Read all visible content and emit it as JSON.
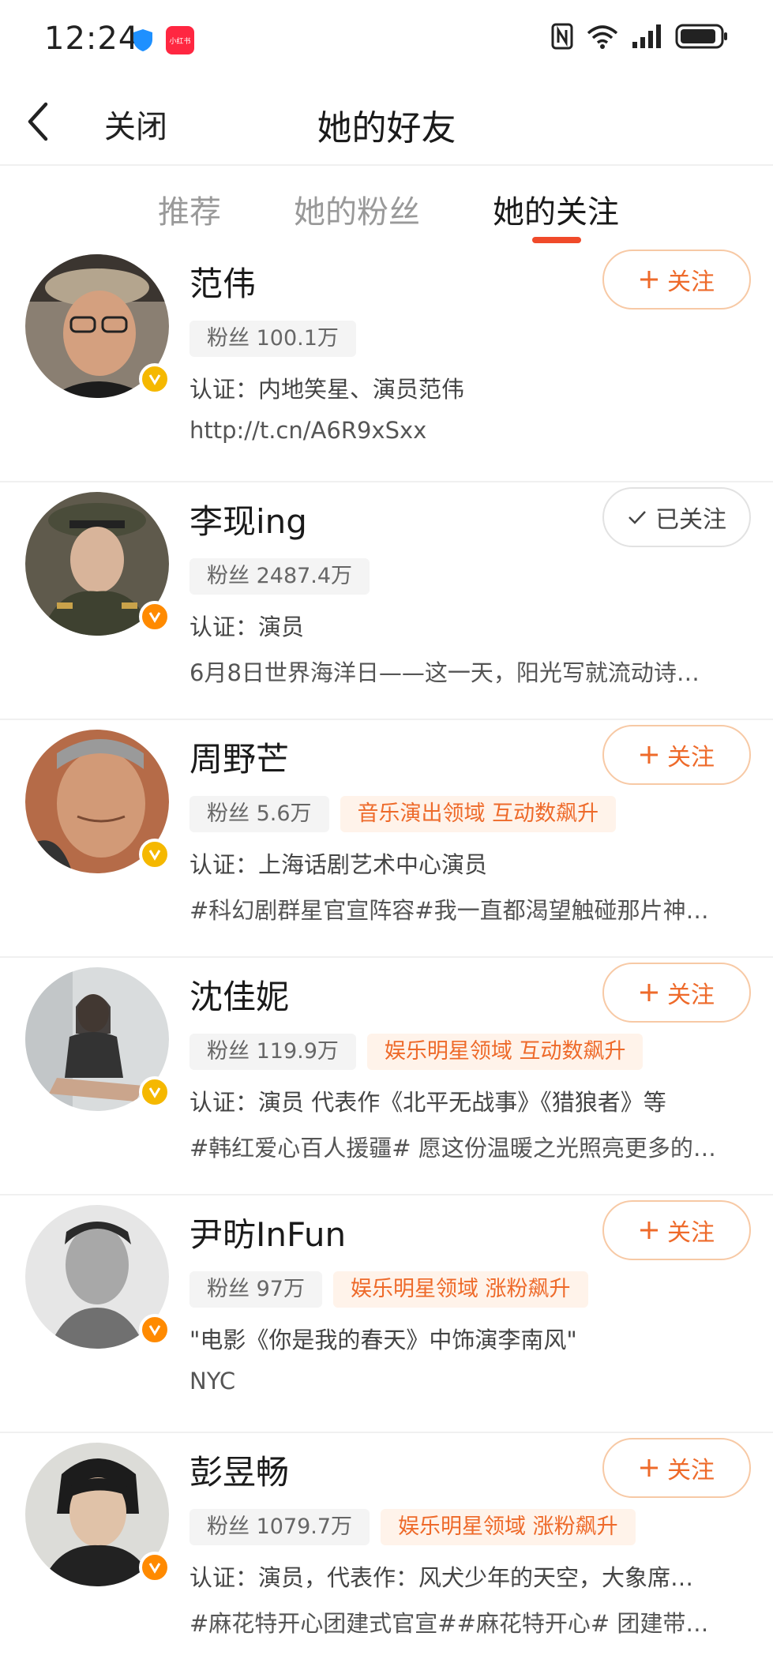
{
  "status_bar": {
    "time": "12:24",
    "app_badge": "小红书"
  },
  "header": {
    "close_label": "关闭",
    "title": "她的好友"
  },
  "tabs": [
    {
      "label": "推荐",
      "active": false
    },
    {
      "label": "她的粉丝",
      "active": false
    },
    {
      "label": "她的关注",
      "active": true
    }
  ],
  "follow_label": "关注",
  "followed_label": "已关注",
  "users": [
    {
      "name": "范伟",
      "fans": "粉丝 100.1万",
      "tag": "",
      "line1": "认证：内地笑星、演员范伟",
      "line2": "http://t.cn/A6R9xSxx",
      "followed": false,
      "badge": "gold"
    },
    {
      "name": "李现ing",
      "fans": "粉丝 2487.4万",
      "tag": "",
      "line1": "认证：演员",
      "line2": "6月8日世界海洋日——这一天，阳光写就流动诗…",
      "followed": true,
      "badge": "red"
    },
    {
      "name": "周野芒",
      "fans": "粉丝 5.6万",
      "tag": "音乐演出领域 互动数飙升",
      "line1": "认证：上海话剧艺术中心演员",
      "line2": "#科幻剧群星官宣阵容#我一直都渴望触碰那片神…",
      "followed": false,
      "badge": "gold"
    },
    {
      "name": "沈佳妮",
      "fans": "粉丝 119.9万",
      "tag": "娱乐明星领域 互动数飙升",
      "line1": "认证：演员 代表作《北平无战事》《猎狼者》等",
      "line2": "#韩红爱心百人援疆# 愿这份温暖之光照亮更多的…",
      "followed": false,
      "badge": "gold"
    },
    {
      "name": "尹昉InFun",
      "fans": "粉丝 97万",
      "tag": "娱乐明星领域 涨粉飙升",
      "line1": "\"电影《你是我的春天》中饰演李南风\"",
      "line2": "NYC",
      "followed": false,
      "badge": "red"
    },
    {
      "name": "彭昱畅",
      "fans": "粉丝 1079.7万",
      "tag": "娱乐明星领域 涨粉飙升",
      "line1": "认证：演员，代表作：风犬少年的天空，大象席…",
      "line2": "#麻花特开心团建式官宣##麻花特开心# 团建带…",
      "followed": false,
      "badge": "red"
    }
  ]
}
